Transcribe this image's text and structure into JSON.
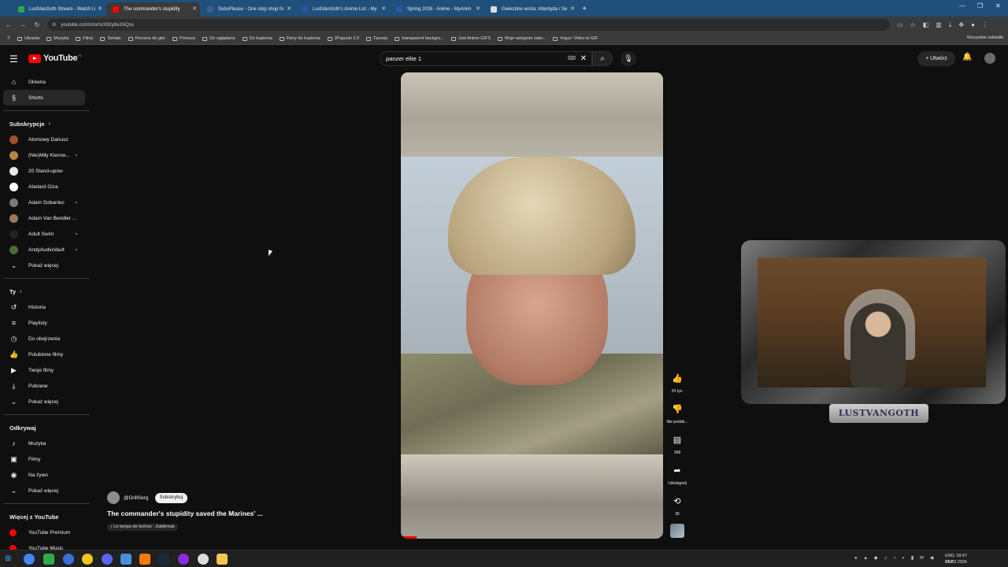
{
  "browser": {
    "tabs": [
      {
        "label": "LustVanGoth Stream - Watch Li",
        "fav_color": "#2eaa4a"
      },
      {
        "label": "The commander's stupidity",
        "fav_color": "#ff0000",
        "active": true
      },
      {
        "label": "SubsPlease - One stop shop fo",
        "fav_color": "#3a5f8a"
      },
      {
        "label": "LustVanGoth's Anime List - My",
        "fav_color": "#2e51a2"
      },
      {
        "label": "Spring 2026 - Anime - MyAnim",
        "fav_color": "#2e51a2"
      },
      {
        "label": "Gwiezdne wrota: Atlantyda / Se",
        "fav_color": "#dddddd"
      }
    ],
    "url": "youtube.com/shorts/X8zy8a1NQus",
    "bookmarks": [
      "Ubrania",
      "Muzyka",
      "Filmy",
      "Seriale",
      "Pomoce do gier",
      "Pomoce",
      "Do oglądania",
      "Do kupienia",
      "Filmy do kupienia",
      "JPopuski 2.0",
      "Tpexep",
      "transparent backgro...",
      "Just Anime GIFS",
      "Moje wstępnie zatw...",
      "Imgur: Video to GIF"
    ],
    "bookmarks_all": "Wszystkie zakładki"
  },
  "header": {
    "logo_text": "YouTube",
    "logo_region": "PL",
    "search_value": "panzer elite 1",
    "create_label": "Utwórz"
  },
  "sidebar": {
    "main": [
      {
        "label": "Główna",
        "icon": "home-icon",
        "glyph": "⌂"
      },
      {
        "label": "Shorts",
        "icon": "shorts-icon",
        "glyph": "§",
        "active": true
      }
    ],
    "subs_title": "Subskrypcje",
    "subs": [
      {
        "label": "Atomowy Dariusz",
        "color": "#a0502a",
        "dot": false
      },
      {
        "label": "(Nie)Miły Kierow...",
        "color": "#b8864a",
        "dot": true
      },
      {
        "label": "20 Stand-upów",
        "color": "#e8e8e8",
        "dot": false
      },
      {
        "label": "Abelard Giza",
        "color": "#ffffff",
        "dot": false
      },
      {
        "label": "Adam Sobaniec",
        "color": "#7a7a7a",
        "dot": true
      },
      {
        "label": "Adam Van Bendler ...",
        "color": "#9a7a5a",
        "dot": false
      },
      {
        "label": "Adult Swim",
        "color": "#222222",
        "dot": true
      },
      {
        "label": "AndyAudioVault",
        "color": "#4a6a3a",
        "dot": true
      }
    ],
    "subs_more": "Pokaż więcej",
    "you_title": "Ty",
    "you": [
      {
        "label": "Historia",
        "icon": "history-icon",
        "glyph": "↺"
      },
      {
        "label": "Playlisty",
        "icon": "playlist-icon",
        "glyph": "≡"
      },
      {
        "label": "Do obejrzenia",
        "icon": "watch-later-icon",
        "glyph": "◷"
      },
      {
        "label": "Polubione filmy",
        "icon": "like-icon",
        "glyph": "👍"
      },
      {
        "label": "Twoje filmy",
        "icon": "your-videos-icon",
        "glyph": "▶"
      },
      {
        "label": "Pobrane",
        "icon": "download-icon",
        "glyph": "⤓"
      }
    ],
    "you_more": "Pokaż więcej",
    "explore_title": "Odkrywaj",
    "explore": [
      {
        "label": "Muzyka",
        "icon": "music-icon",
        "glyph": "♪"
      },
      {
        "label": "Filmy",
        "icon": "movies-icon",
        "glyph": "▣"
      },
      {
        "label": "Na żywo",
        "icon": "live-icon",
        "glyph": "◉"
      }
    ],
    "explore_more": "Pokaż więcej",
    "more_title": "Więcej z YouTube",
    "more": [
      {
        "label": "YouTube Premium",
        "color": "#ff0000"
      },
      {
        "label": "YouTube Music",
        "color": "#ff0000"
      }
    ]
  },
  "short": {
    "channel": "@DrillSerg",
    "subscribe": "Subskrybuj",
    "title": "The commander's stupidity saved the Marines' ...",
    "music": "♪ Le temps de techno · Zaldbreak",
    "actions": {
      "like_count": "24 tys.",
      "dislike_label": "Nie podob...",
      "comment_count": "368",
      "share_label": "Udostępnij",
      "remix_count": "36"
    },
    "progress": 0.06
  },
  "overlay": {
    "plaque_text": "LUSTVANGOTH"
  },
  "taskbar": {
    "lang_top": "ENG",
    "lang_bottom": "PLP",
    "time": "18:47",
    "date": "24.03.2026"
  }
}
